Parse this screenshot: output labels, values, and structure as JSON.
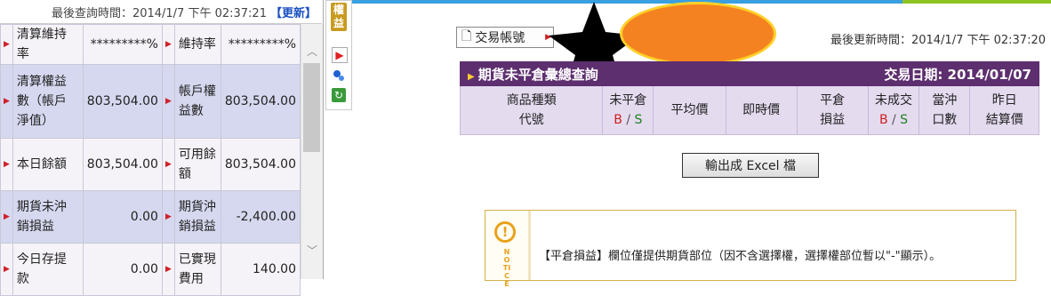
{
  "query": {
    "label": "最後查詢時間：2014/1/7 下午 02:37:21",
    "refresh": "【更新】"
  },
  "rights_panel": {
    "rows": [
      {
        "label": "清算維持率",
        "value": "*********%",
        "label2": "維持率",
        "value2": "*********%"
      },
      {
        "label": "清算權益數（帳戶淨值）",
        "value": "803,504.00",
        "label2": "帳戶權益數",
        "value2": "803,504.00"
      },
      {
        "label": "本日餘額",
        "value": "803,504.00",
        "label2": "可用餘額",
        "value2": "803,504.00"
      },
      {
        "label": "期貨未沖銷損益",
        "value": "0.00",
        "label2": "期貨沖銷損益",
        "value2": "-2,400.00"
      },
      {
        "label": "今日存提款",
        "value": "0.00",
        "label2": "已實現費用",
        "value2": "140.00"
      }
    ],
    "side_tag": "權益",
    "tools": [
      "play-icon",
      "pin-icon",
      "refresh-icon"
    ]
  },
  "account_button": {
    "label": "交易帳號"
  },
  "last_update": "最後更新時間：2014/1/7 下午 02:37:20",
  "positions": {
    "title": "期貨未平倉彙總查詢",
    "trade_date": "交易日期: 2014/01/07",
    "columns": [
      {
        "line1": "商品種類",
        "line2": "代號"
      },
      {
        "line1": "未平倉",
        "b": "B",
        "s": "S"
      },
      {
        "line1": "平均價",
        "line2": ""
      },
      {
        "line1": "即時價",
        "line2": ""
      },
      {
        "line1": "平倉",
        "line2": "損益"
      },
      {
        "line1": "未成交",
        "b": "B",
        "s": "S"
      },
      {
        "line1": "當沖",
        "line2": "口數"
      },
      {
        "line1": "昨日",
        "line2": "結算價"
      }
    ]
  },
  "export_button": "輸出成 Excel 檔",
  "notice": {
    "vertical": "NOTICE",
    "text": "【平倉損益】欄位僅提供期貨部位（因不含選擇權，選擇權部位暫以\"-\"顯示）。"
  },
  "colors": {
    "header_bg": "#5d2f6f",
    "cols_bg": "#e4dbef",
    "accent_red": "#d02020",
    "accent_green": "#208020",
    "redaction_orange": "#f58220",
    "notice_orange": "#e8a21a"
  }
}
